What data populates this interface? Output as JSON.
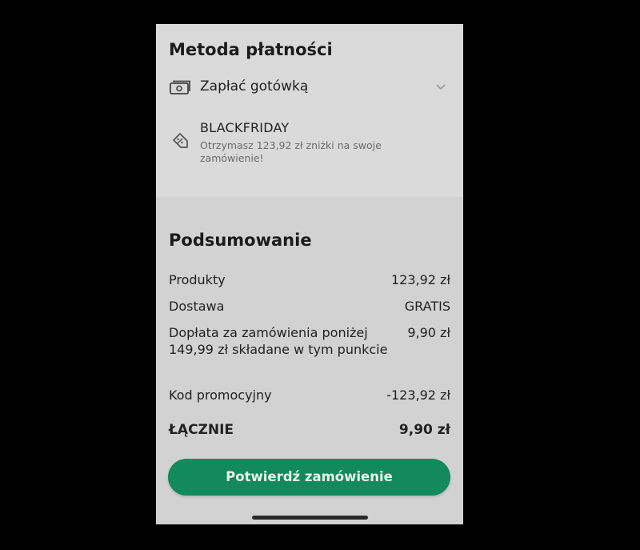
{
  "payment": {
    "title": "Metoda płatności",
    "method_label": "Zapłać gotówką",
    "method_icon": "cash-icon",
    "promo_code": "BLACKFRIDAY",
    "promo_description": "Otrzymasz 123,92 zł zniżki na swoje zamówienie!",
    "promo_icon": "discount-tag-icon"
  },
  "summary": {
    "title": "Podsumowanie",
    "rows": [
      {
        "label": "Produkty",
        "value": "123,92 zł"
      },
      {
        "label": "Dostawa",
        "value": "GRATIS"
      },
      {
        "label": "Dopłata za zamówienia poniżej 149,99 zł składane w tym punkcie",
        "value": "9,90 zł"
      },
      {
        "label": "Kod promocyjny",
        "value": "-123,92 zł"
      }
    ],
    "total_label": "ŁĄCZNIE",
    "total_value": "9,90 zł"
  },
  "actions": {
    "confirm_label": "Potwierdź zamówienie"
  },
  "colors": {
    "accent": "#138a5e",
    "background": "#d2d2d2"
  }
}
